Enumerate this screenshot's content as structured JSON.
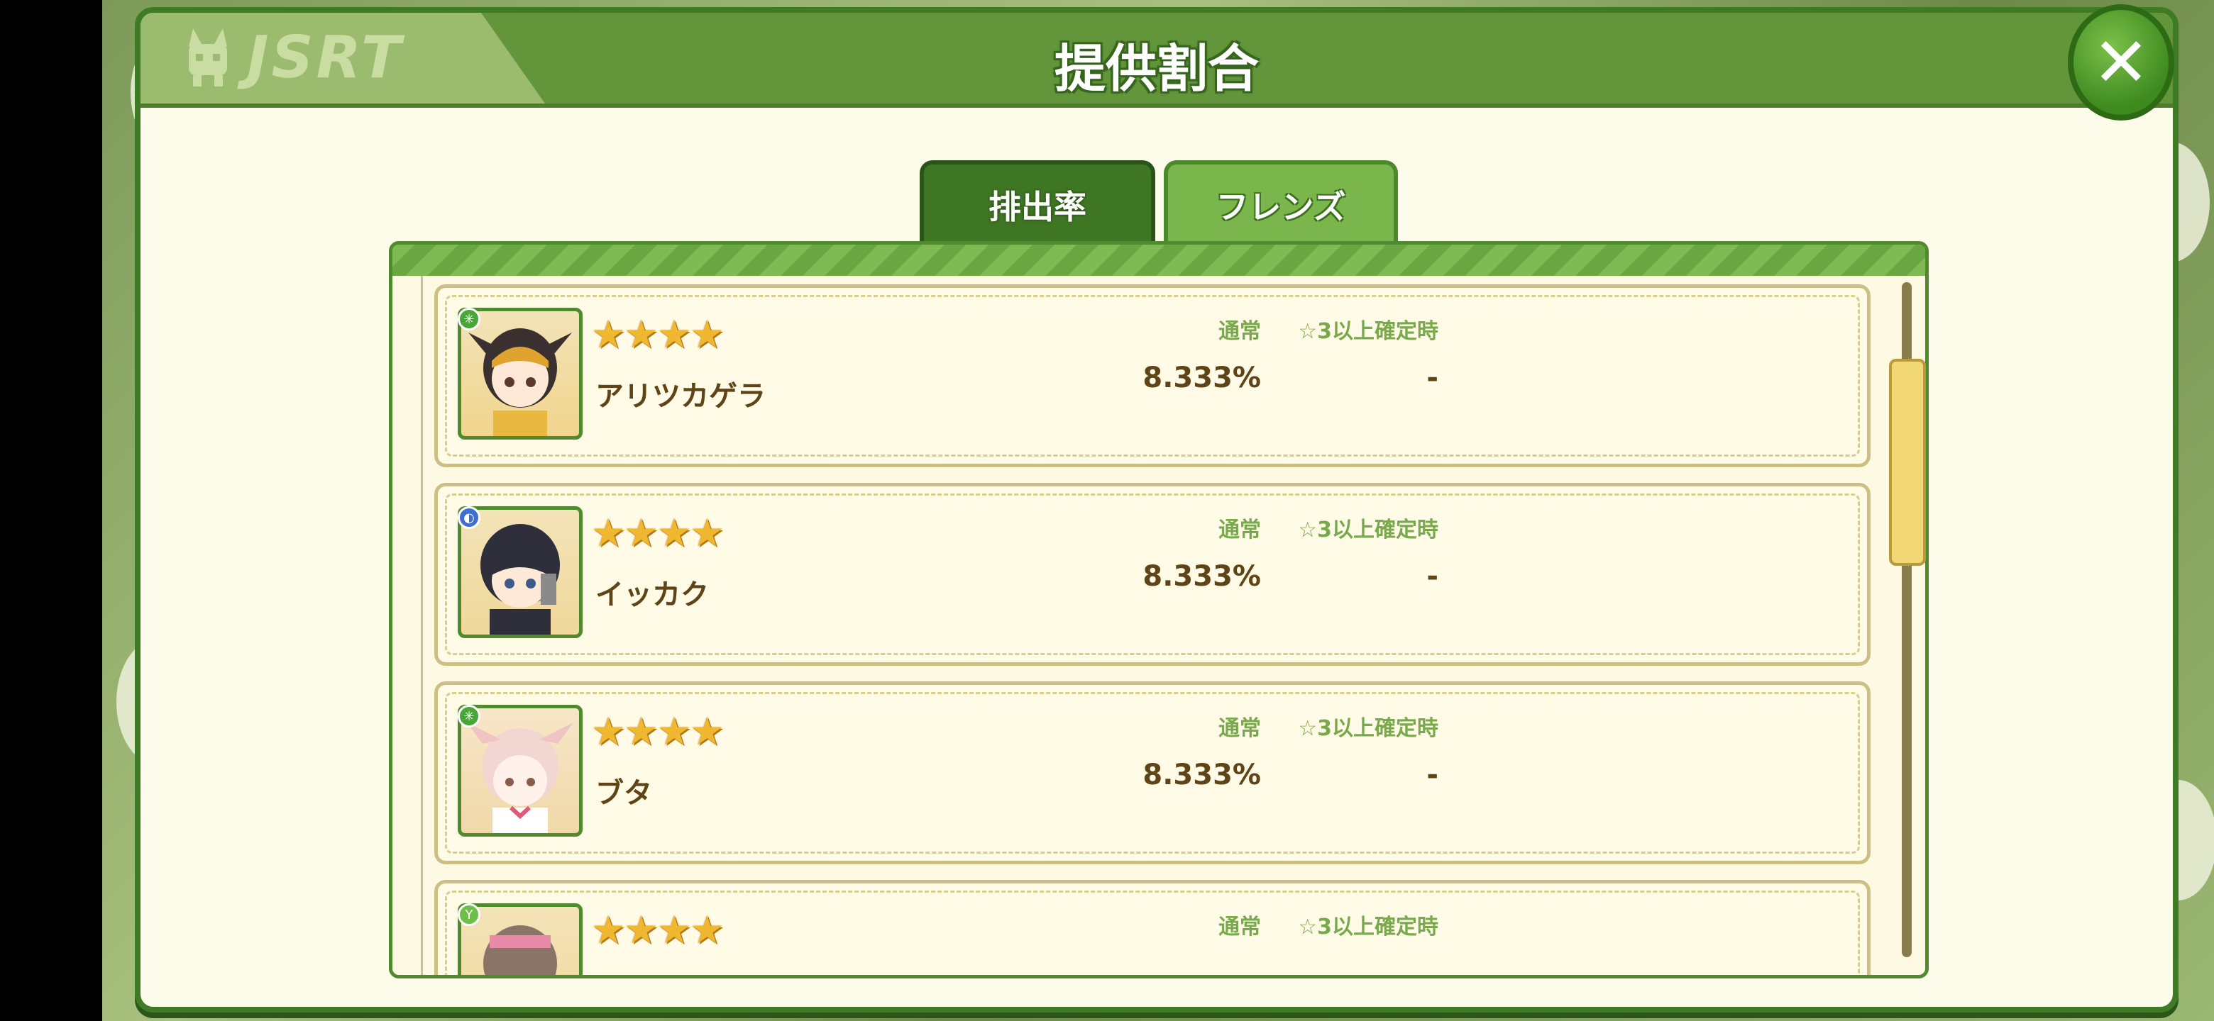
{
  "header": {
    "title": "提供割合",
    "logo": "JSRT",
    "close_label": "✕"
  },
  "tabs": [
    {
      "label": "排出率",
      "selected": false
    },
    {
      "label": "フレンズ",
      "selected": true
    }
  ],
  "columns": {
    "normal": "通常",
    "guaranteed": "☆3以上確定時"
  },
  "friends": [
    {
      "name": "アリツカゲラ",
      "stars": "★★★★",
      "normal_rate": "8.333%",
      "guaranteed_rate": "-",
      "attribute_icon": "forest-attribute-icon",
      "attr_color": "#4aa53a"
    },
    {
      "name": "イッカク",
      "stars": "★★★★",
      "normal_rate": "8.333%",
      "guaranteed_rate": "-",
      "attribute_icon": "water-attribute-icon",
      "attr_color": "#3d6fd1"
    },
    {
      "name": "ブタ",
      "stars": "★★★★",
      "normal_rate": "8.333%",
      "guaranteed_rate": "-",
      "attribute_icon": "forest-attribute-icon",
      "attr_color": "#4aa53a"
    },
    {
      "name": "",
      "stars": "★★★★",
      "normal_rate": "",
      "guaranteed_rate": "",
      "attribute_icon": "plant-attribute-icon",
      "attr_color": "#6dbf4a"
    }
  ],
  "colors": {
    "accent_green": "#63953b",
    "panel_bg": "#fdfbe9",
    "text_brown": "#5e4417",
    "label_green": "#78a94c"
  }
}
